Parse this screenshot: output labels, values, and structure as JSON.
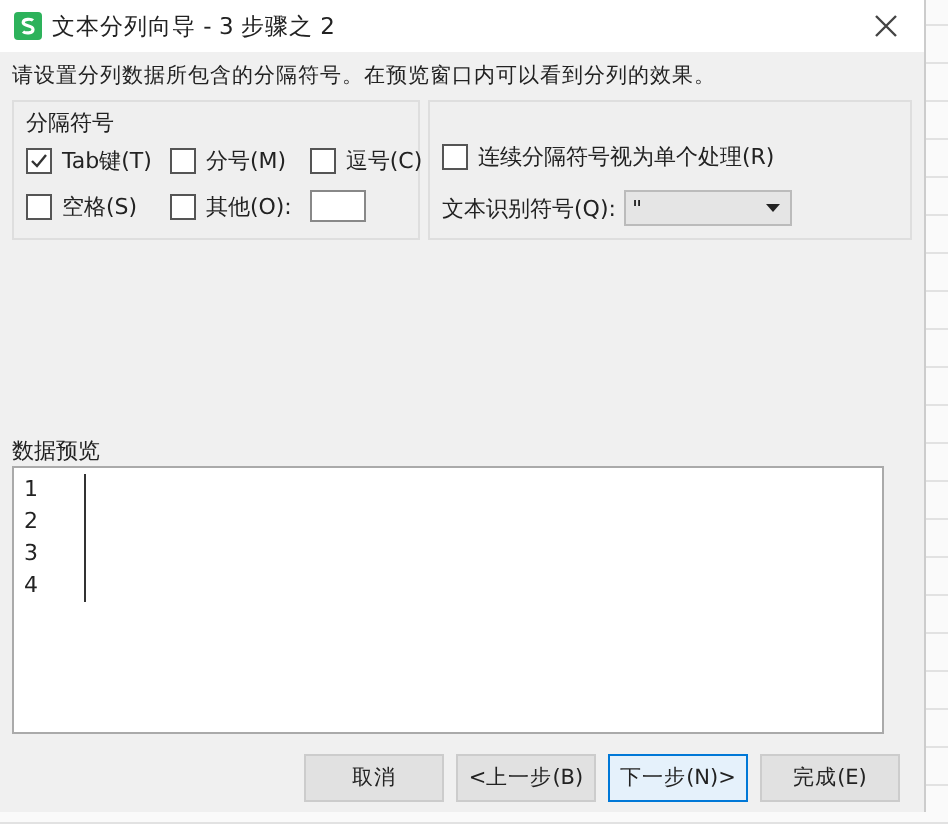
{
  "window": {
    "title": "文本分列向导 - 3 步骤之 2"
  },
  "instruction": "请设置分列数据所包含的分隔符号。在预览窗口内可以看到分列的效果。",
  "delimiters": {
    "title": "分隔符号",
    "options": [
      {
        "label": "Tab键(T)",
        "checked": true
      },
      {
        "label": "分号(M)",
        "checked": false
      },
      {
        "label": "逗号(C)",
        "checked": false
      },
      {
        "label": "空格(S)",
        "checked": false
      },
      {
        "label": "其他(O):",
        "checked": false
      }
    ]
  },
  "consecutive": {
    "label": "连续分隔符号视为单个处理(R)",
    "checked": false
  },
  "text_qualifier": {
    "label": "文本识别符号(Q):",
    "value": "\""
  },
  "preview": {
    "title": "数据预览",
    "rows": [
      "1",
      "2",
      "3",
      "4"
    ]
  },
  "buttons": [
    {
      "label": "取消",
      "selected": false
    },
    {
      "label": "<上一步(B)",
      "selected": false
    },
    {
      "label": "下一步(N)>",
      "selected": true
    },
    {
      "label": "完成(E)",
      "selected": false
    }
  ]
}
